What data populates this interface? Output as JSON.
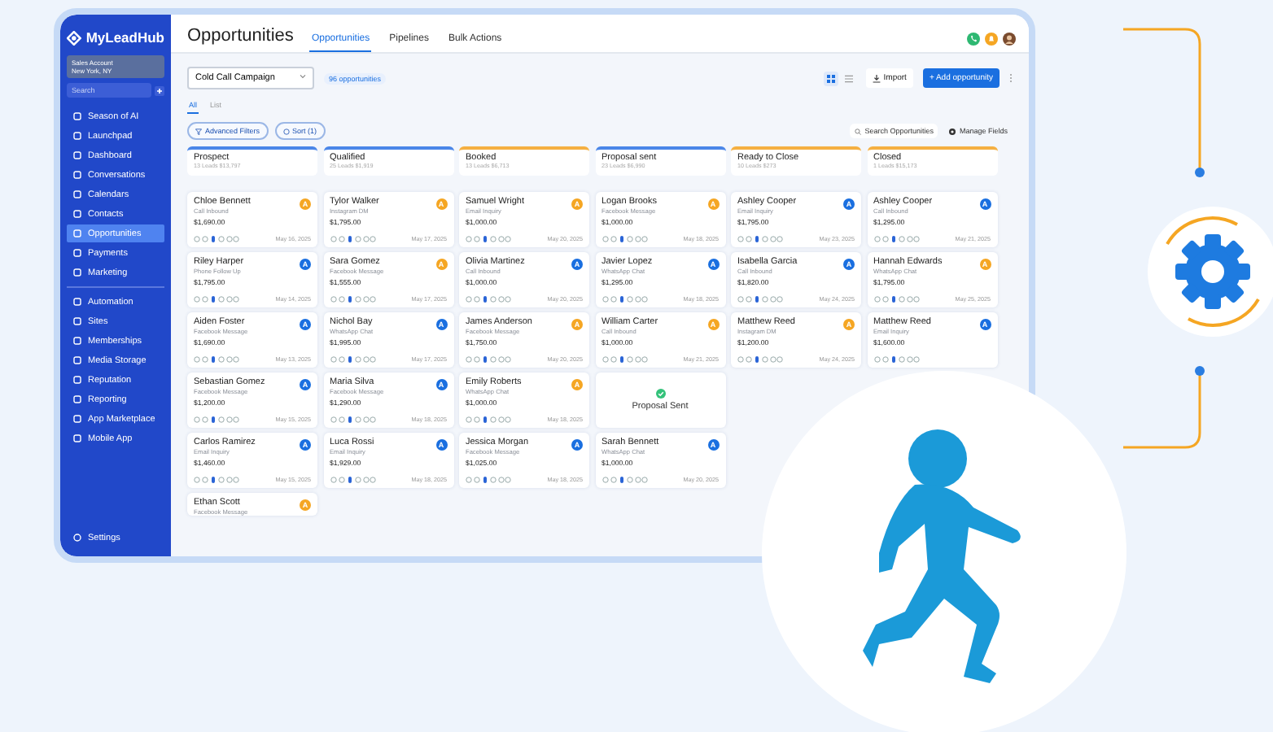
{
  "sidebar": {
    "logo": "MyLeadHub",
    "account": {
      "name": "Sales Account",
      "location": "New York, NY"
    },
    "search": {
      "placeholder": "Search"
    },
    "items": [
      {
        "label": "Season of AI",
        "selected": false
      },
      {
        "label": "Launchpad",
        "selected": false
      },
      {
        "label": "Dashboard",
        "selected": false
      },
      {
        "label": "Conversations",
        "selected": false
      },
      {
        "label": "Calendars",
        "selected": false
      },
      {
        "label": "Contacts",
        "selected": false
      },
      {
        "label": "Opportunities",
        "selected": true
      },
      {
        "label": "Payments",
        "selected": false
      },
      {
        "label": "Marketing",
        "selected": false
      },
      {
        "label": "Automation",
        "selected": false
      },
      {
        "label": "Sites",
        "selected": false
      },
      {
        "label": "Memberships",
        "selected": false
      },
      {
        "label": "Media Storage",
        "selected": false
      },
      {
        "label": "Reputation",
        "selected": false
      },
      {
        "label": "Reporting",
        "selected": false
      },
      {
        "label": "App Marketplace",
        "selected": false
      },
      {
        "label": "Mobile App",
        "selected": false
      }
    ],
    "settings": "Settings"
  },
  "header": {
    "title": "Opportunities",
    "tabs": [
      {
        "label": "Opportunities",
        "selected": true
      },
      {
        "label": "Pipelines",
        "selected": false
      },
      {
        "label": "Bulk Actions",
        "selected": false
      }
    ]
  },
  "toolbar": {
    "pipeline": "Cold Call Campaign",
    "count": "96 opportunities",
    "views": [
      {
        "kind": "grid",
        "selected": true
      },
      {
        "kind": "list",
        "selected": false
      }
    ],
    "import": "Import",
    "add": "+ Add opportunity"
  },
  "view_tabs": [
    {
      "label": "All",
      "selected": true
    },
    {
      "label": "List",
      "selected": false
    }
  ],
  "filters": {
    "advanced": "Advanced Filters",
    "sort": "Sort (1)",
    "search": "Search Opportunities",
    "manage": "Manage Fields"
  },
  "columns": [
    {
      "title": "Prospect",
      "summary": "13 Leads  $13,797",
      "color": "#4a86e8",
      "cards": [
        {
          "kind": "lead",
          "name": "Chloe Bennett",
          "source": "Call Inbound",
          "amount": "$1,690.00",
          "date": "May 16, 2025",
          "initial": "A",
          "color": "#f5a623"
        },
        {
          "kind": "lead",
          "name": "Riley Harper",
          "source": "Phone Follow Up",
          "amount": "$1,795.00",
          "date": "May 14, 2025",
          "initial": "A",
          "color": "#1a6fe0"
        },
        {
          "kind": "lead",
          "name": "Aiden Foster",
          "source": "Facebook Message",
          "amount": "$1,690.00",
          "date": "May 13, 2025",
          "initial": "A",
          "color": "#1a6fe0"
        },
        {
          "kind": "lead",
          "name": "Sebastian Gomez",
          "source": "Facebook Message",
          "amount": "$1,200.00",
          "date": "May 15, 2025",
          "initial": "A",
          "color": "#1a6fe0"
        },
        {
          "kind": "lead",
          "name": "Carlos Ramirez",
          "source": "Email Inquiry",
          "amount": "$1,460.00",
          "date": "May 15, 2025",
          "initial": "A",
          "color": "#1a6fe0"
        },
        {
          "kind": "partial",
          "name": "Ethan Scott",
          "source": "Facebook Message",
          "initial": "A",
          "color": "#f5a623"
        }
      ]
    },
    {
      "title": "Qualified",
      "summary": "25 Leads  $1,919",
      "color": "#4a86e8",
      "cards": [
        {
          "kind": "lead",
          "name": "Tylor Walker",
          "source": "Instagram DM",
          "amount": "$1,795.00",
          "date": "May 17, 2025",
          "initial": "A",
          "color": "#f5a623"
        },
        {
          "kind": "lead",
          "name": "Sara Gomez",
          "source": "Facebook Message",
          "amount": "$1,555.00",
          "date": "May 17, 2025",
          "initial": "A",
          "color": "#f5a623"
        },
        {
          "kind": "lead",
          "name": "Nichol Bay",
          "source": "WhatsApp Chat",
          "amount": "$1,995.00",
          "date": "May 17, 2025",
          "initial": "A",
          "color": "#1a6fe0"
        },
        {
          "kind": "lead",
          "name": "Maria Silva",
          "source": "Facebook Message",
          "amount": "$1,290.00",
          "date": "May 18, 2025",
          "initial": "A",
          "color": "#1a6fe0"
        },
        {
          "kind": "lead",
          "name": "Luca Rossi",
          "source": "Email Inquiry",
          "amount": "$1,929.00",
          "date": "May 18, 2025",
          "initial": "A",
          "color": "#1a6fe0"
        }
      ]
    },
    {
      "title": "Booked",
      "summary": "13 Leads  $6,713",
      "color": "#f5b041",
      "cards": [
        {
          "kind": "lead",
          "name": "Samuel Wright",
          "source": "Email Inquiry",
          "amount": "$1,000.00",
          "date": "May 20, 2025",
          "initial": "A",
          "color": "#f5a623"
        },
        {
          "kind": "lead",
          "name": "Olivia Martinez",
          "source": "Call Inbound",
          "amount": "$1,000.00",
          "date": "May 20, 2025",
          "initial": "A",
          "color": "#1a6fe0"
        },
        {
          "kind": "lead",
          "name": "James Anderson",
          "source": "Facebook Message",
          "amount": "$1,750.00",
          "date": "May 20, 2025",
          "initial": "A",
          "color": "#f5a623"
        },
        {
          "kind": "lead",
          "name": "Emily Roberts",
          "source": "WhatsApp Chat",
          "amount": "$1,000.00",
          "date": "May 18, 2025",
          "initial": "A",
          "color": "#f5a623"
        },
        {
          "kind": "lead",
          "name": "Jessica Morgan",
          "source": "Facebook Message",
          "amount": "$1,025.00",
          "date": "May 18, 2025",
          "initial": "A",
          "color": "#1a6fe0"
        }
      ]
    },
    {
      "title": "Proposal sent",
      "summary": "23 Leads  $6,990",
      "color": "#4a86e8",
      "cards": [
        {
          "kind": "lead",
          "name": "Logan Brooks",
          "source": "Facebook Message",
          "amount": "$1,000.00",
          "date": "May 18, 2025",
          "initial": "A",
          "color": "#f5a623"
        },
        {
          "kind": "lead",
          "name": "Javier Lopez",
          "source": "WhatsApp Chat",
          "amount": "$1,295.00",
          "date": "May 18, 2025",
          "initial": "A",
          "color": "#1a6fe0"
        },
        {
          "kind": "lead",
          "name": "William Carter",
          "source": "Call Inbound",
          "amount": "$1,000.00",
          "date": "May 21, 2025",
          "initial": "A",
          "color": "#f5a623"
        },
        {
          "kind": "status",
          "label": "Proposal Sent"
        },
        {
          "kind": "lead",
          "name": "Sarah Bennett",
          "source": "WhatsApp Chat",
          "amount": "$1,000.00",
          "date": "May 20, 2025",
          "initial": "A",
          "color": "#1a6fe0"
        }
      ]
    },
    {
      "title": "Ready to Close",
      "summary": "10 Leads  $273",
      "color": "#f5b041",
      "cards": [
        {
          "kind": "lead",
          "name": "Ashley Cooper",
          "source": "Email Inquiry",
          "amount": "$1,795.00",
          "date": "May 23, 2025",
          "initial": "A",
          "color": "#1a6fe0"
        },
        {
          "kind": "lead",
          "name": "Isabella Garcia",
          "source": "Call Inbound",
          "amount": "$1,820.00",
          "date": "May 24, 2025",
          "initial": "A",
          "color": "#1a6fe0"
        },
        {
          "kind": "lead",
          "name": "Matthew Reed",
          "source": "Instagram DM",
          "amount": "$1,200.00",
          "date": "May 24, 2025",
          "initial": "A",
          "color": "#f5a623"
        }
      ]
    },
    {
      "title": "Closed",
      "summary": "1 Leads  $15,173",
      "color": "#f5b041",
      "cards": [
        {
          "kind": "lead",
          "name": "Ashley Cooper",
          "source": "Call Inbound",
          "amount": "$1,295.00",
          "date": "May 21, 2025",
          "initial": "A",
          "color": "#1a6fe0"
        },
        {
          "kind": "lead",
          "name": "Hannah Edwards",
          "source": "WhatsApp Chat",
          "amount": "$1,795.00",
          "date": "May 25, 2025",
          "initial": "A",
          "color": "#f5a623"
        },
        {
          "kind": "lead",
          "name": "Matthew Reed",
          "source": "Email Inquiry",
          "amount": "$1,600.00",
          "initial": "A",
          "color": "#1a6fe0"
        }
      ]
    }
  ]
}
